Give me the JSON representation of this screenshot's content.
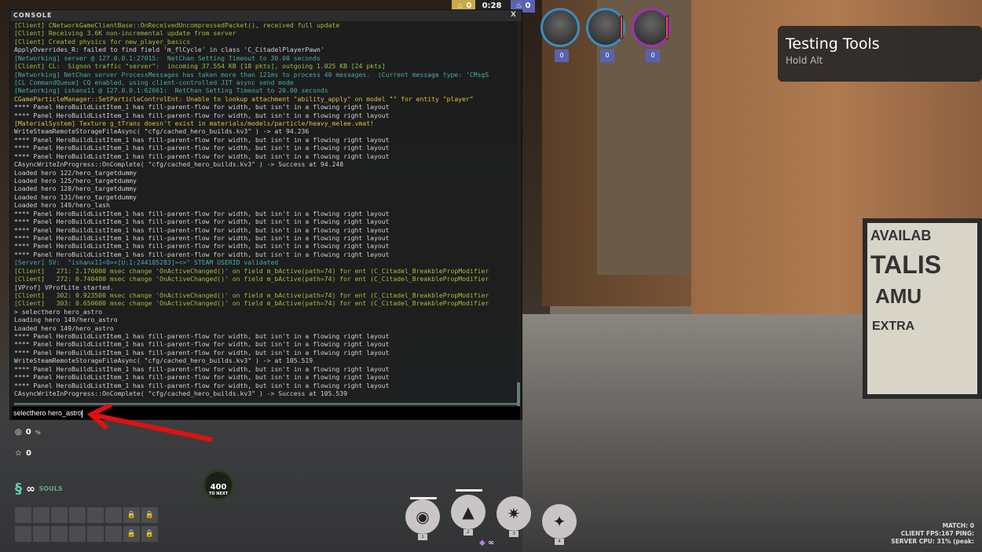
{
  "top_hud": {
    "left_souls": "0",
    "timer": "0:28",
    "right_souls": "0"
  },
  "console": {
    "title": "CONSOLE",
    "close_label": "X",
    "colors": {
      "client": "#9fbf3a",
      "net": "#4aa8a8",
      "white": "#d0d0d0",
      "yellow": "#d4c43a"
    },
    "lines": [
      {
        "c": "client",
        "t": "[Client] CNetworkGameClientBase::OnReceivedUncompressedPacket(), received full update"
      },
      {
        "c": "client",
        "t": "[Client] Receiving 3.6K non-incremental update from server"
      },
      {
        "c": "client",
        "t": "[Client] Created physics for new_player_basics"
      },
      {
        "c": "white",
        "t": "ApplyOverrides_R: failed to find field 'm_flCycle' in class 'C_CitadelPlayerPawn'"
      },
      {
        "c": "net",
        "t": "[Networking] server @ 127.0.0.1:27015:  NetChan Setting Timeout to 30.00 seconds"
      },
      {
        "c": "client",
        "t": "[Client] CL:  Signon traffic \"server\":  incoming 37.554 KB [18 pkts], outgoing 1.025 KB [24 pkts]"
      },
      {
        "c": "net",
        "t": "[Networking] NetChan server ProcessMessages has taken more than 121ms to process 40 messages.  (Current message type: 'CMsgS"
      },
      {
        "c": "net",
        "t": "[CL CommandQueue] CQ enabled, using client-controlled JIT async send mode"
      },
      {
        "c": "net",
        "t": "[Networking] ishanx11 @ 127.0.0.1:62661:  NetChan Setting Timeout to 20.00 seconds"
      },
      {
        "c": "yellow",
        "t": "CGameParticleManager::SetParticleControlEnt: Unable to lookup attachment \"ability_apply\" on model \"\" for entity \"player\""
      },
      {
        "c": "white",
        "t": "**** Panel HeroBuildListItem_1 has fill-parent-flow for width, but isn't in a flowing right layout"
      },
      {
        "c": "white",
        "t": "**** Panel HeroBuildListItem_1 has fill-parent-flow for width, but isn't in a flowing right layout"
      },
      {
        "c": "yellow",
        "t": "[MaterialSystem] Texture g_tTrans doesn't exist in materials/models/particle/heavy_melee.vmat!"
      },
      {
        "c": "white",
        "t": "WriteSteamRemoteStorageFileAsync( \"cfg/cached_hero_builds.kv3\" ) -> at 94.236"
      },
      {
        "c": "white",
        "t": "**** Panel HeroBuildListItem_1 has fill-parent-flow for width, but isn't in a flowing right layout"
      },
      {
        "c": "white",
        "t": "**** Panel HeroBuildListItem_1 has fill-parent-flow for width, but isn't in a flowing right layout"
      },
      {
        "c": "white",
        "t": "**** Panel HeroBuildListItem_1 has fill-parent-flow for width, but isn't in a flowing right layout"
      },
      {
        "c": "white",
        "t": "CAsyncWriteInProgress::OnComplete( \"cfg/cached_hero_builds.kv3\" ) -> Success at 94.248"
      },
      {
        "c": "white",
        "t": "Loaded hero 122/hero_targetdummy"
      },
      {
        "c": "white",
        "t": "Loaded hero 125/hero_targetdummy"
      },
      {
        "c": "white",
        "t": "Loaded hero 128/hero_targetdummy"
      },
      {
        "c": "white",
        "t": "Loaded hero 131/hero_targetdummy"
      },
      {
        "c": "white",
        "t": "Loaded hero 149/hero_lash"
      },
      {
        "c": "white",
        "t": "**** Panel HeroBuildListItem_1 has fill-parent-flow for width, but isn't in a flowing right layout"
      },
      {
        "c": "white",
        "t": "**** Panel HeroBuildListItem_1 has fill-parent-flow for width, but isn't in a flowing right layout"
      },
      {
        "c": "white",
        "t": "**** Panel HeroBuildListItem_1 has fill-parent-flow for width, but isn't in a flowing right layout"
      },
      {
        "c": "white",
        "t": "**** Panel HeroBuildListItem_1 has fill-parent-flow for width, but isn't in a flowing right layout"
      },
      {
        "c": "white",
        "t": "**** Panel HeroBuildListItem_1 has fill-parent-flow for width, but isn't in a flowing right layout"
      },
      {
        "c": "white",
        "t": "**** Panel HeroBuildListItem_1 has fill-parent-flow for width, but isn't in a flowing right layout"
      },
      {
        "c": "net",
        "t": "[Server] SV:  \"ishanx11<0><[U:1:244185283]><>\" STEAM USERID validated"
      },
      {
        "c": "client",
        "t": "[Client]   271: 2.176000 msec change 'OnActiveChanged()' on field m_bActive(path=74) for ent (C_Citadel_BreakblePropModifier"
      },
      {
        "c": "client",
        "t": "[Client]   272: 0.740400 msec change 'OnActiveChanged()' on field m_bActive(path=74) for ent (C_Citadel_BreakblePropModifier"
      },
      {
        "c": "white",
        "t": "[VProf] VProfLite started."
      },
      {
        "c": "client",
        "t": "[Client]   302: 0.923500 msec change 'OnActiveChanged()' on field m_bActive(path=74) for ent (C_Citadel_BreakblePropModifier"
      },
      {
        "c": "client",
        "t": "[Client]   303: 0.650600 msec change 'OnActiveChanged()' on field m_bActive(path=74) for ent (C_Citadel_BreakblePropModifier"
      },
      {
        "c": "white",
        "t": "> selecthero hero_astro"
      },
      {
        "c": "white",
        "t": "Loading hero 149/hero_astro"
      },
      {
        "c": "white",
        "t": "Loaded hero 149/hero_astro"
      },
      {
        "c": "white",
        "t": "**** Panel HeroBuildListItem_1 has fill-parent-flow for width, but isn't in a flowing right layout"
      },
      {
        "c": "white",
        "t": "**** Panel HeroBuildListItem_1 has fill-parent-flow for width, but isn't in a flowing right layout"
      },
      {
        "c": "white",
        "t": "**** Panel HeroBuildListItem_1 has fill-parent-flow for width, but isn't in a flowing right layout"
      },
      {
        "c": "white",
        "t": "WriteSteamRemoteStorageFileAsync( \"cfg/cached_hero_builds.kv3\" ) -> at 105.519"
      },
      {
        "c": "white",
        "t": "**** Panel HeroBuildListItem_1 has fill-parent-flow for width, but isn't in a flowing right layout"
      },
      {
        "c": "white",
        "t": "**** Panel HeroBuildListItem_1 has fill-parent-flow for width, but isn't in a flowing right layout"
      },
      {
        "c": "white",
        "t": "**** Panel HeroBuildListItem_1 has fill-parent-flow for width, but isn't in a flowing right layout"
      },
      {
        "c": "white",
        "t": "CAsyncWriteInProgress::OnComplete( \"cfg/cached_hero_builds.kv3\" ) -> Success at 105.539"
      }
    ],
    "input_value": "selecthero hero_astro"
  },
  "testing_tools": {
    "title": "Testing Tools",
    "hint": "Hold Alt"
  },
  "heroes": [
    {
      "level": "0",
      "ring": "#3a8cbf"
    },
    {
      "level": "0",
      "ring": "#3a8cbf"
    },
    {
      "level": "0",
      "ring": "#a030b0"
    }
  ],
  "stats": {
    "objective_value": "0",
    "objective_unit": "%",
    "stars": "0",
    "souls_label": "SOULS"
  },
  "souls_badge": {
    "value": "400",
    "label": "TO NEXT"
  },
  "abilities": [
    {
      "num": "1",
      "icon": "vortex-icon"
    },
    {
      "num": "2",
      "icon": "hat-icon"
    },
    {
      "num": "3",
      "icon": "blast-icon"
    },
    {
      "num": "4",
      "icon": "kick-icon"
    }
  ],
  "scene_sign": {
    "line1": "AVAILAB",
    "line2": "TALIS",
    "line3": "AMU",
    "line4": "EXTRA"
  },
  "perf": {
    "match": "MATCH: 0",
    "fps": "CLIENT FPS:167  PING:",
    "cpu": "SERVER CPU: 31% (peak:"
  }
}
